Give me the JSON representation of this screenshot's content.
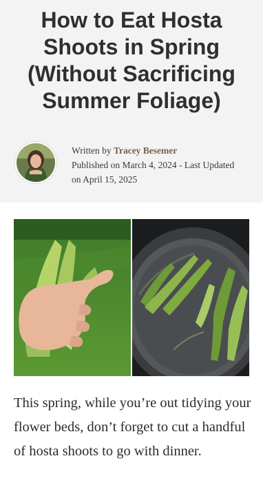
{
  "article": {
    "title": "How to Eat Hosta Shoots in Spring (Without Sacrificing Summer Foliage)",
    "byline": {
      "written_by_prefix": "Written by ",
      "author": "Tracey Besemer",
      "published": "Published on March 4, 2024 - Last Updated on April 15, 2025"
    },
    "lead": "This spring, while you’re out tidying your flower beds, don’t forget to cut a handful of hosta shoots to go with dinner."
  },
  "images": [
    {
      "name": "hand-holding-hosta-shoots-photo"
    },
    {
      "name": "hosta-shoots-in-skillet-photo"
    }
  ],
  "colors": {
    "header_bg": "#f3f3f3",
    "title": "#2f2f2f",
    "author_link": "#7a5f47"
  }
}
